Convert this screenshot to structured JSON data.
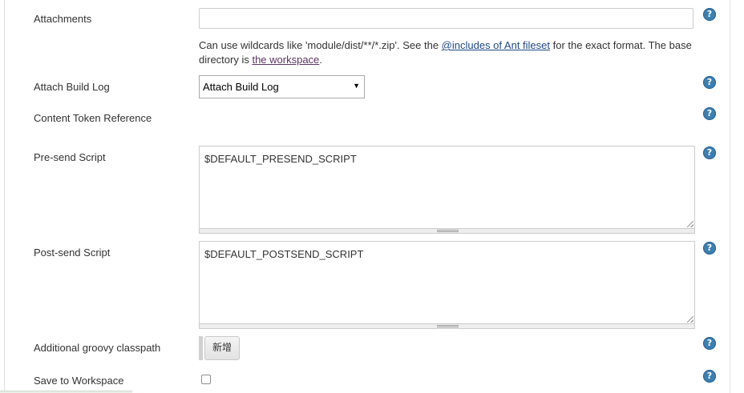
{
  "form": {
    "attachments": {
      "label": "Attachments",
      "value": "",
      "hint_prefix": "Can use wildcards like 'module/dist/**/*.zip'. See the ",
      "hint_link1": "@includes of Ant fileset",
      "hint_middle": " for the exact format. The base directory is ",
      "hint_link2": "the workspace",
      "hint_suffix": "."
    },
    "attach_build_log": {
      "label": "Attach Build Log",
      "selected": "Attach Build Log"
    },
    "content_token_reference": {
      "label": "Content Token Reference"
    },
    "presend_script": {
      "label": "Pre-send Script",
      "value": "$DEFAULT_PRESEND_SCRIPT"
    },
    "postsend_script": {
      "label": "Post-send Script",
      "value": "$DEFAULT_POSTSEND_SCRIPT"
    },
    "groovy_classpath": {
      "label": "Additional groovy classpath",
      "button_label": "新增"
    },
    "save_to_workspace": {
      "label": "Save to Workspace",
      "checked": false
    },
    "help_icon_glyph": "?"
  },
  "colors": {
    "help_icon": "#3c7fb1",
    "link": "#204a87",
    "visited_link": "#5c3566"
  }
}
